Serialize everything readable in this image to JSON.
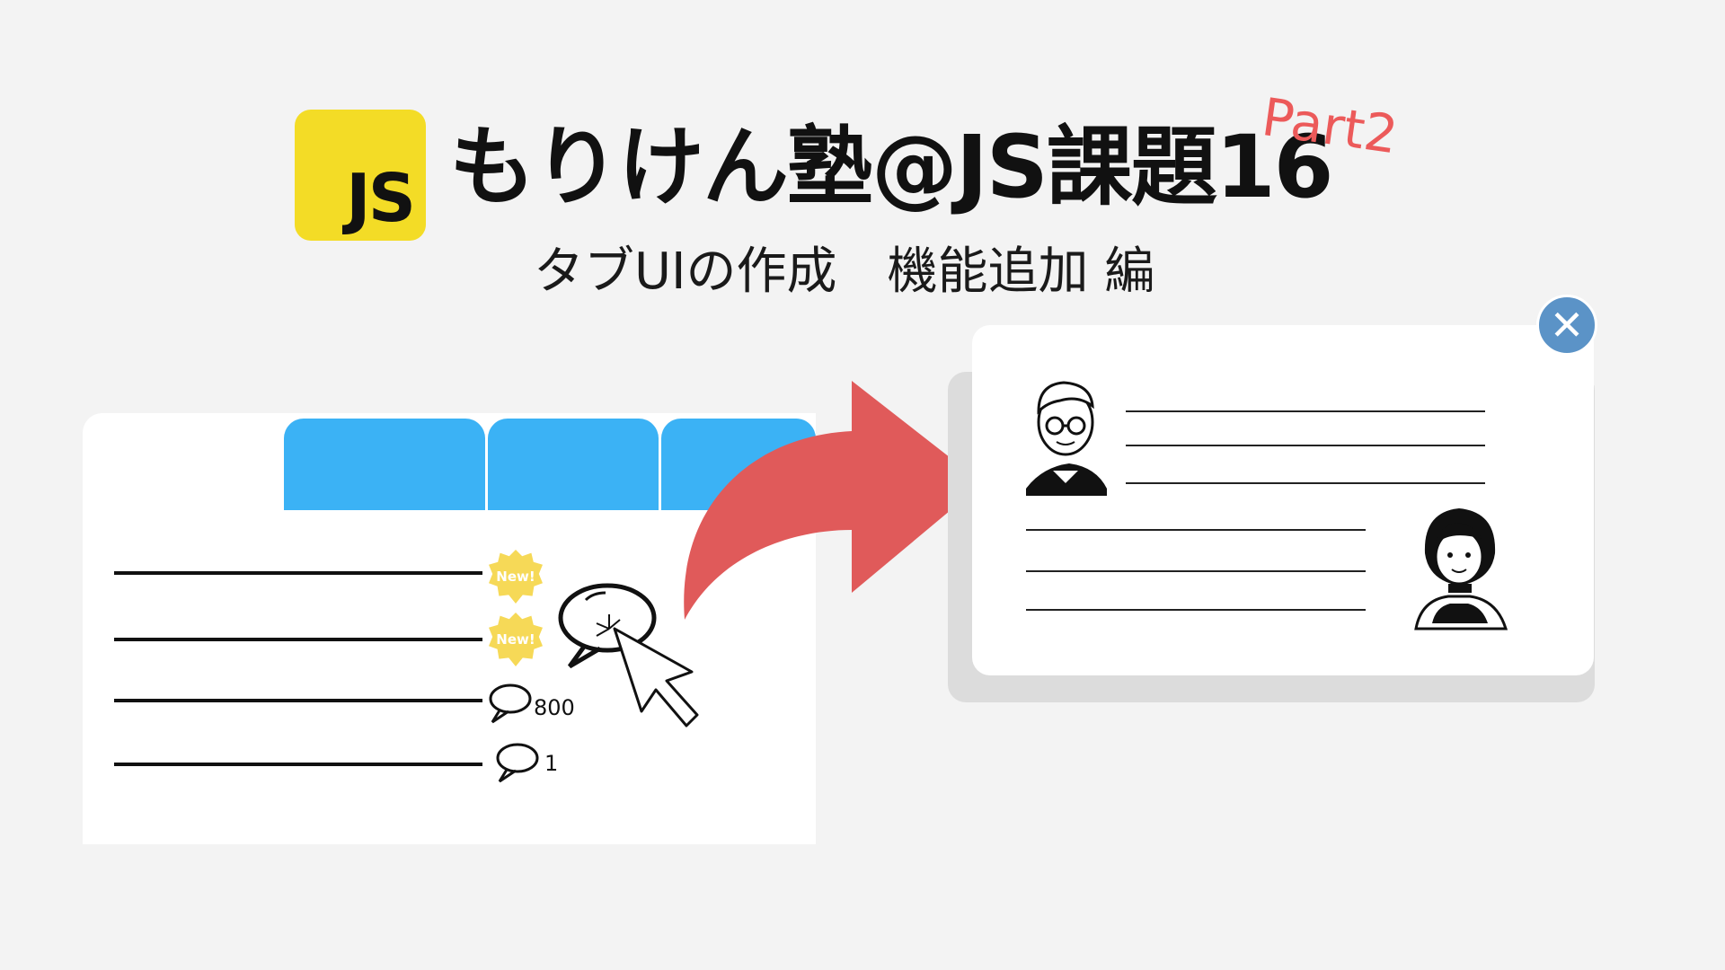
{
  "logo": {
    "text": "JS"
  },
  "header": {
    "title": "もりけん塾@JS課題16",
    "part": "Part2",
    "subtitle": "タブUIの作成　機能追加 編"
  },
  "list": {
    "badges": [
      "New!",
      "New!"
    ],
    "counts": [
      "800",
      "1"
    ]
  },
  "colors": {
    "background": "#f3f3f3",
    "tab": "#3bb2f5",
    "arrow": "#e05a5a",
    "badge": "#f6d957",
    "logo": "#f3dc26",
    "close": "#5b93c7",
    "part": "#ec5a5a"
  },
  "icons": [
    "close-icon",
    "comment-icon",
    "cursor-icon",
    "arrow-icon",
    "man-avatar",
    "woman-avatar"
  ]
}
